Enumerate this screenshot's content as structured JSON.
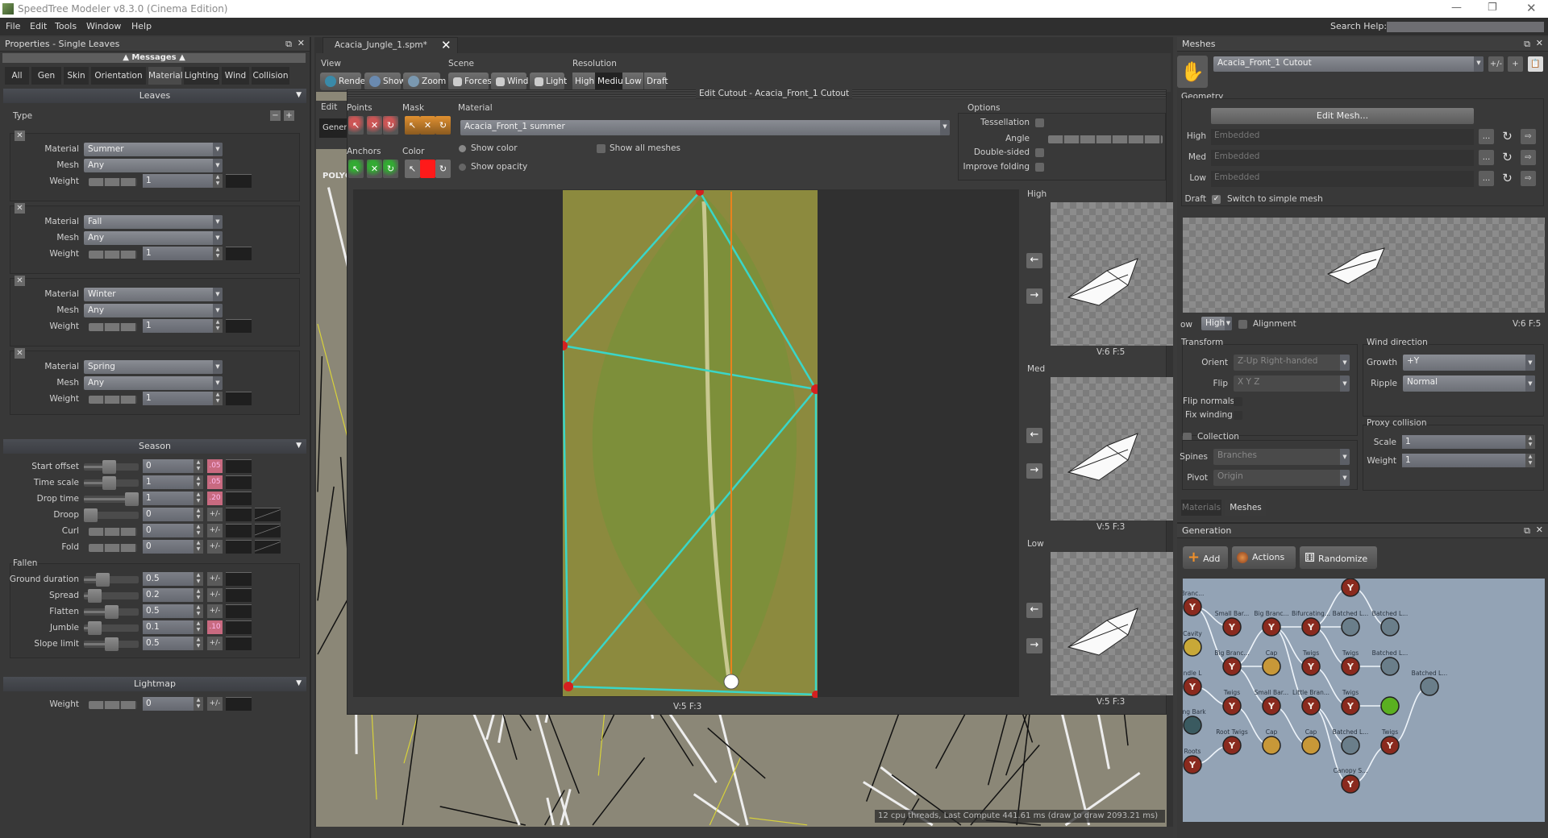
{
  "window": {
    "title": "SpeedTree Modeler v8.3.0 (Cinema Edition)",
    "controls": [
      "minimize",
      "maximize",
      "close"
    ]
  },
  "menu": [
    "File",
    "Edit",
    "Tools",
    "Window",
    "Help"
  ],
  "search": {
    "label": "Search Help:",
    "value": ""
  },
  "properties": {
    "title": "Properties - Single Leaves",
    "messages": "Messages",
    "tabs": [
      "All",
      "Gen",
      "Skin",
      "Orientation",
      "Material",
      "Lighting",
      "Wind",
      "Collision"
    ],
    "active_tab": "Material",
    "leaves_header": "Leaves",
    "type_label": "Type",
    "type_groups": [
      {
        "material": "Summer",
        "mesh": "Any",
        "weight": "1"
      },
      {
        "material": "Fall",
        "mesh": "Any",
        "weight": "1"
      },
      {
        "material": "Winter",
        "mesh": "Any",
        "weight": "1"
      },
      {
        "material": "Spring",
        "mesh": "Any",
        "weight": "1"
      }
    ],
    "row_labels": {
      "material": "Material",
      "mesh": "Mesh",
      "weight": "Weight"
    },
    "season_header": "Season",
    "season_rows": [
      {
        "label": "Start offset",
        "value": "0",
        "slider": 0.45,
        "btn": ".05",
        "btn_active": true,
        "curve2": false
      },
      {
        "label": "Time scale",
        "value": "1",
        "slider": 0.45,
        "btn": ".05",
        "btn_active": true,
        "curve2": false
      },
      {
        "label": "Drop time",
        "value": "1",
        "slider": 1.0,
        "btn": ".20",
        "btn_active": true,
        "curve2": false
      },
      {
        "label": "Droop",
        "value": "0",
        "slider": 0.0,
        "btn": "+/-",
        "btn_active": false,
        "curve2": true
      },
      {
        "label": "Curl",
        "value": "0",
        "slider": null,
        "btn": "+/-",
        "btn_active": false,
        "curve2": true
      },
      {
        "label": "Fold",
        "value": "0",
        "slider": null,
        "btn": "+/-",
        "btn_active": false,
        "curve2": true
      }
    ],
    "fallen_label": "Fallen",
    "fallen_rows": [
      {
        "label": "Ground duration",
        "value": "0.5",
        "slider": 0.3,
        "btn": "+/-",
        "btn_active": false
      },
      {
        "label": "Spread",
        "value": "0.2",
        "slider": 0.1,
        "btn": "+/-",
        "btn_active": false
      },
      {
        "label": "Flatten",
        "value": "0.5",
        "slider": 0.5,
        "btn": "+/-",
        "btn_active": false
      },
      {
        "label": "Jumble",
        "value": "0.1",
        "slider": 0.1,
        "btn": ".10",
        "btn_active": true
      },
      {
        "label": "Slope limit",
        "value": "0.5",
        "slider": 0.5,
        "btn": "+/-",
        "btn_active": false
      }
    ],
    "lightmap_header": "Lightmap",
    "lightmap_weight": {
      "label": "Weight",
      "value": "0",
      "btn": "+/-"
    }
  },
  "document": {
    "tab": "Acacia_Jungle_1.spm*",
    "view": {
      "label": "View",
      "buttons": [
        "Render",
        "Show",
        "Zoom"
      ]
    },
    "scene": {
      "label": "Scene",
      "buttons": [
        "Forces",
        "Wind",
        "Light"
      ]
    },
    "resolution": {
      "label": "Resolution",
      "buttons": [
        "High",
        "Medium",
        "Low",
        "Draft"
      ],
      "selected": "Medium"
    },
    "viewport_label": "POLYGC",
    "status": "12 cpu threads, Last Compute 441.61 ms (draw to draw 2093.21 ms)"
  },
  "cutout": {
    "title": "Edit Cutout - Acacia_Front_1 Cutout",
    "edit_label": "Edit",
    "general_button": "Gener:",
    "points_label": "Points",
    "anchors_label": "Anchors",
    "mask_label": "Mask",
    "color_label": "Color",
    "paint_color": "#ff1a1a",
    "material_label": "Material",
    "material_value": "Acacia_Front_1 summer",
    "show_color": "Show color",
    "show_opacity": "Show opacity",
    "show_all_meshes": "Show all  meshes",
    "options": {
      "label": "Options",
      "tessellation": "Tessellation",
      "angle": "Angle",
      "double_sided": "Double-sided",
      "improve_folding": "Improve folding"
    },
    "canvas_stats": "V:5 F:3",
    "lods": [
      {
        "label": "High",
        "stats": "V:6 F:5"
      },
      {
        "label": "Med",
        "stats": "V:5 F:3"
      },
      {
        "label": "Low",
        "stats": "V:5 F:3"
      }
    ],
    "outline_color": "#3ad6c8",
    "axis_color": "#e8821e"
  },
  "meshes": {
    "title": "Meshes",
    "selected_mesh": "Acacia_Front_1 Cutout",
    "buttons": [
      "+/-",
      "+",
      "paste"
    ],
    "geometry_label": "Geometry",
    "edit_mesh": "Edit Mesh...",
    "lod_rows": [
      {
        "label": "High",
        "value": "Embedded"
      },
      {
        "label": "Med",
        "value": "Embedded"
      },
      {
        "label": "Low",
        "value": "Embedded"
      }
    ],
    "draft_label": "Draft",
    "draft_check": "Switch to simple mesh",
    "draft_checked": true,
    "show_label": "ow",
    "show_value": "High",
    "alignment": "Alignment",
    "preview_stats": "V:6  F:5",
    "transform": {
      "label": "Transform",
      "orient_label": "Orient",
      "orient": "Z-Up Right-handed",
      "flip_label": "Flip",
      "flip": "X Y Z",
      "flip_normals": "Flip normals",
      "fix_winding": "Fix winding"
    },
    "collection": {
      "label": "Collection",
      "spines_label": "Spines",
      "spines": "Branches",
      "pivot_label": "Pivot",
      "pivot": "Origin"
    },
    "wind": {
      "label": "Wind direction",
      "growth_label": "Growth",
      "growth": "+Y",
      "ripple_label": "Ripple",
      "ripple": "Normal"
    },
    "proxy": {
      "label": "Proxy collision",
      "scale_label": "Scale",
      "scale": "1",
      "weight_label": "Weight",
      "weight": "1"
    },
    "tabs": [
      "Materials",
      "Meshes"
    ],
    "active_tab": "Meshes"
  },
  "generation": {
    "title": "Generation",
    "buttons": [
      "Add",
      "Actions",
      "Randomize"
    ],
    "nodes": [
      {
        "label": "Branc...",
        "type": "branch"
      },
      {
        "label": "Small Bar...",
        "type": "branch"
      },
      {
        "label": "Big Branc...",
        "type": "branch"
      },
      {
        "label": "Bifurcating...",
        "type": "branch"
      },
      {
        "label": "",
        "type": "branch"
      },
      {
        "label": "Batched L...",
        "type": "leaf"
      },
      {
        "label": "Batched L...",
        "type": "leaf"
      },
      {
        "label": "Cavity",
        "type": "cavity"
      },
      {
        "label": "Big Branc...",
        "type": "branch"
      },
      {
        "label": "Cap",
        "type": "cap"
      },
      {
        "label": "Twigs",
        "type": "branch"
      },
      {
        "label": "Twigs",
        "type": "branch"
      },
      {
        "label": "Batched L...",
        "type": "leaf"
      },
      {
        "label": "Batched L...",
        "type": "leaf"
      },
      {
        "label": "ndle L",
        "type": "branch"
      },
      {
        "label": "Twigs",
        "type": "branch"
      },
      {
        "label": "Small Bar...",
        "type": "branch"
      },
      {
        "label": "Little Bran...",
        "type": "branch"
      },
      {
        "label": "Twigs",
        "type": "branch"
      },
      {
        "label": "",
        "type": "green"
      },
      {
        "label": "ling Bark",
        "type": "bark"
      },
      {
        "label": "Root Twigs",
        "type": "branch"
      },
      {
        "label": "Cap",
        "type": "cap"
      },
      {
        "label": "Cap",
        "type": "cap"
      },
      {
        "label": "Batched L...",
        "type": "leaf"
      },
      {
        "label": "Twigs",
        "type": "branch"
      },
      {
        "label": "Roots",
        "type": "branch"
      },
      {
        "label": "Canopy S...",
        "type": "branch"
      }
    ]
  }
}
